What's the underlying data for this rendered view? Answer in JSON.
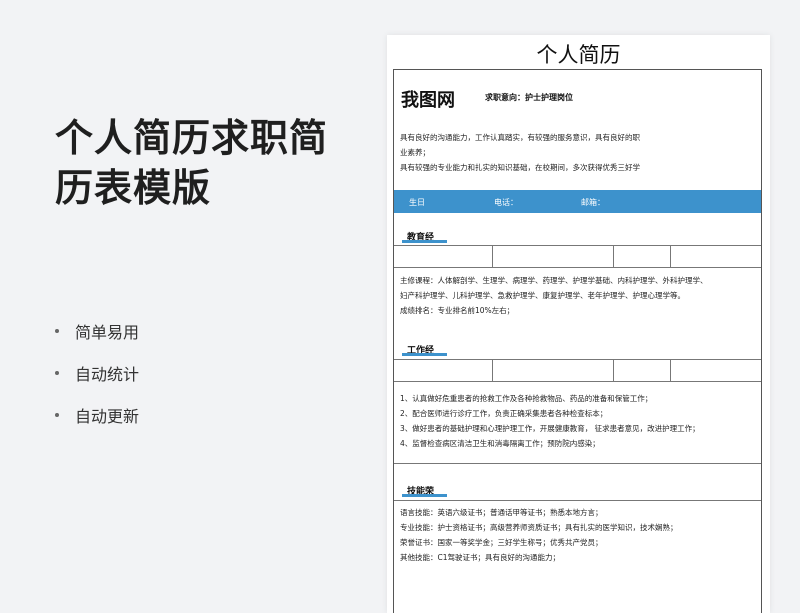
{
  "left": {
    "title": "个人简历求职简历表模版",
    "features": [
      "简单易用",
      "自动统计",
      "自动更新"
    ]
  },
  "resume": {
    "title": "个人简历",
    "name": "我图网",
    "intent": "求职意向：护士护理岗位",
    "summary": [
      "具有良好的沟通能力，工作认真踏实，有较强的服务意识，具有良好的职",
      "业素养；",
      "具有较强的专业能力和扎实的知识基础，在校期间，多次获得优秀三好学"
    ],
    "contact": {
      "birthday": "生日",
      "phone": "电话：",
      "email": "邮箱："
    },
    "education": {
      "heading": "教育经",
      "lines": [
        "主修课程：人体解剖学、生理学、病理学、药理学、护理学基础、内科护理学、外科护理学、",
        "妇产科护理学、儿科护理学、急救护理学、康复护理学、老年护理学、护理心理学等。",
        "成绩排名：专业排名前10%左右；"
      ]
    },
    "work": {
      "heading": "工作经",
      "lines": [
        "1、认真做好危重患者的抢救工作及各种抢救物品、药品的准备和保管工作；",
        "2、配合医师进行诊疗工作，负责正确采集患者各种检查标本；",
        "3、做好患者的基础护理和心理护理工作，开展健康教育，  征求患者意见，改进护理工作；",
        "4、监督检查病区清洁卫生和消毒隔离工作；预防院内感染；"
      ]
    },
    "skills": {
      "heading": "技能荣",
      "lines": [
        "语言技能：英语六级证书；普通话甲等证书；熟悉本地方言；",
        "专业技能：护士资格证书；高级营养师资质证书；具有扎实的医学知识，技术娴熟；",
        "荣誉证书：国家一等奖学金；三好学生称号；优秀共产党员；",
        "其他技能：C1驾驶证书；具有良好的沟通能力；"
      ]
    }
  }
}
